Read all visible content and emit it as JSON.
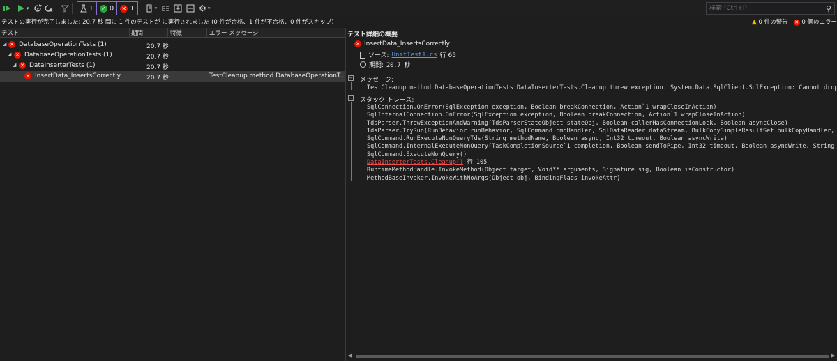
{
  "toolbar": {
    "flask_count": "1",
    "passed_count": "0",
    "failed_count": "1",
    "search_placeholder": "検索 (Ctrl+I)"
  },
  "status": {
    "message": "テストの実行が完了しました: 20.7 秒 間に 1 件のテストが に実行されました (0 件が合格、1 件が不合格、0 件がスキップ)",
    "warnings": "0 件の警告",
    "errors": "0 個のエラー"
  },
  "columns": {
    "test": "テスト",
    "duration": "期間",
    "traits": "特徴",
    "error_message": "エラー メッセージ"
  },
  "tree": [
    {
      "name": "DatabaseOperationTests (1)",
      "duration": "20.7 秒",
      "error": ""
    },
    {
      "name": "DatabaseOperationTests (1)",
      "duration": "20.7 秒",
      "error": ""
    },
    {
      "name": "DataInserterTests (1)",
      "duration": "20.7 秒",
      "error": ""
    },
    {
      "name": "InsertData_InsertsCorrectly",
      "duration": "20.7 秒",
      "error": "TestCleanup method DatabaseOperationT..."
    }
  ],
  "details": {
    "title": "テスト詳細の概要",
    "test_name": "InsertData_InsertsCorrectly",
    "source_label": "ソース:",
    "source_file": "UnitTest1.cs",
    "source_line": "行 65",
    "duration_label": "期間:",
    "duration_value": "20.7 秒",
    "message_label": "メッセージ:",
    "message_text": "TestCleanup method DatabaseOperationTests.DataInserterTests.Cleanup threw exception. System.Data.SqlClient.SqlException: Cannot drop databa",
    "stack_label": "スタック トレース:",
    "stack": [
      "SqlConnection.OnError(SqlException exception, Boolean breakConnection, Action`1 wrapCloseInAction)",
      "SqlInternalConnection.OnError(SqlException exception, Boolean breakConnection, Action`1 wrapCloseInAction)",
      "TdsParser.ThrowExceptionAndWarning(TdsParserStateObject stateObj, Boolean callerHasConnectionLock, Boolean asyncClose)",
      "TdsParser.TryRun(RunBehavior runBehavior, SqlCommand cmdHandler, SqlDataReader dataStream, BulkCopySimpleResultSet bulkCopyHandler, TdsPars",
      "SqlCommand.RunExecuteNonQueryTds(String methodName, Boolean async, Int32 timeout, Boolean asyncWrite)",
      "SqlCommand.InternalExecuteNonQuery(TaskCompletionSource`1 completion, Boolean sendToPipe, Int32 timeout, Boolean asyncWrite, String methodN",
      "SqlCommand.ExecuteNonQuery()"
    ],
    "stack_link": "DataInserterTests.Cleanup()",
    "stack_link_line": "行 105",
    "stack_after": [
      "RuntimeMethodHandle.InvokeMethod(Object target, Void** arguments, Signature sig, Boolean isConstructor)",
      "MethodBaseInvoker.InvokeWithNoArgs(Object obj, BindingFlags invokeAttr)"
    ]
  },
  "colors": {
    "accent": "#8370cf",
    "failed": "#e51400",
    "passed": "#2ea043",
    "link": "#5d9bf0",
    "stack_link": "#f14c4c"
  }
}
